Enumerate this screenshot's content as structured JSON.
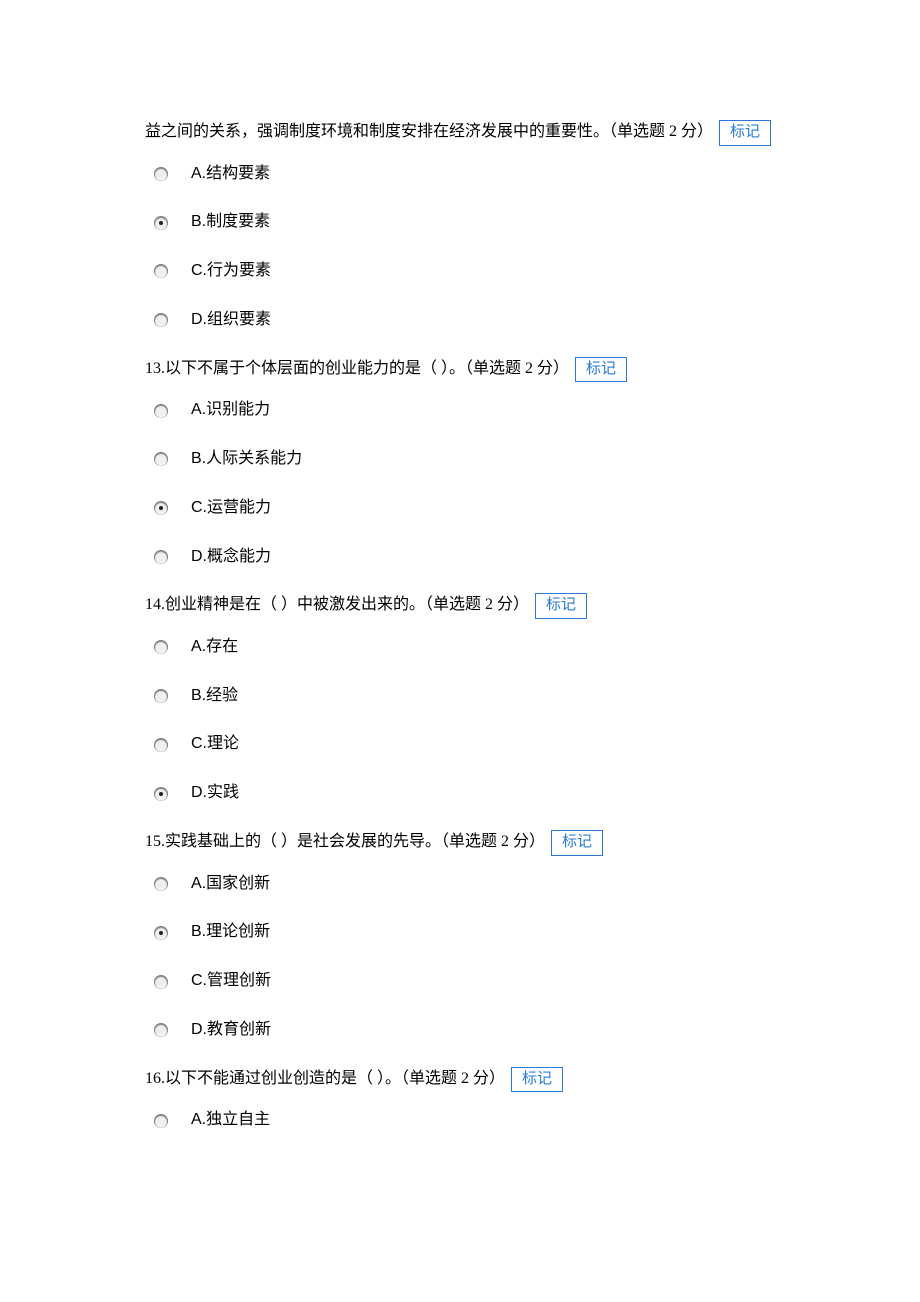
{
  "mark_label": "标记",
  "questions": [
    {
      "number": "",
      "text": "益之间的关系，强调制度环境和制度安排在经济发展中的重要性。（单选题 2 分）",
      "has_mark": true,
      "options": [
        {
          "label": "A.结构要素",
          "selected": false
        },
        {
          "label": "B.制度要素",
          "selected": true
        },
        {
          "label": "C.行为要素",
          "selected": false
        },
        {
          "label": "D.组织要素",
          "selected": false
        }
      ]
    },
    {
      "number": "13.",
      "text": "以下不属于个体层面的创业能力的是（  ）。（单选题 2 分）",
      "has_mark": true,
      "options": [
        {
          "label": "A.识别能力",
          "selected": false
        },
        {
          "label": "B.人际关系能力",
          "selected": false
        },
        {
          "label": "C.运营能力",
          "selected": true
        },
        {
          "label": "D.概念能力",
          "selected": false
        }
      ]
    },
    {
      "number": "14.",
      "text": "创业精神是在（  ）中被激发出来的。（单选题 2 分）",
      "has_mark": true,
      "options": [
        {
          "label": "A.存在",
          "selected": false
        },
        {
          "label": "B.经验",
          "selected": false
        },
        {
          "label": "C.理论",
          "selected": false
        },
        {
          "label": "D.实践",
          "selected": true
        }
      ]
    },
    {
      "number": "15.",
      "text": "实践基础上的（  ）是社会发展的先导。（单选题 2 分）",
      "has_mark": true,
      "options": [
        {
          "label": "A.国家创新",
          "selected": false
        },
        {
          "label": "B.理论创新",
          "selected": true
        },
        {
          "label": "C.管理创新",
          "selected": false
        },
        {
          "label": "D.教育创新",
          "selected": false
        }
      ]
    },
    {
      "number": "16.",
      "text": "以下不能通过创业创造的是（  ）。（单选题 2 分）",
      "has_mark": true,
      "options": [
        {
          "label": "A.独立自主",
          "selected": false
        }
      ]
    }
  ]
}
